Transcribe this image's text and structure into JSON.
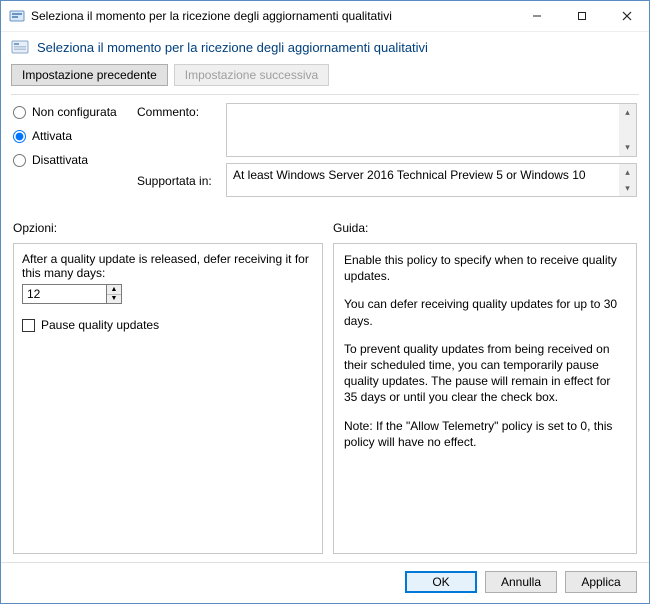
{
  "titlebar": {
    "title": "Seleziona il momento per la ricezione degli aggiornamenti qualitativi"
  },
  "header": {
    "title": "Seleziona il momento per la ricezione degli aggiornamenti qualitativi"
  },
  "nav": {
    "prev": "Impostazione precedente",
    "next": "Impostazione successiva"
  },
  "state": {
    "not_configured": "Non configurata",
    "enabled": "Attivata",
    "disabled": "Disattivata",
    "selected": "enabled"
  },
  "labels": {
    "comment": "Commento:",
    "supported": "Supportata in:",
    "options": "Opzioni:",
    "help": "Guida:"
  },
  "supported_text": "At least Windows Server 2016 Technical Preview 5 or Windows 10",
  "options": {
    "defer_label": "After a quality update is released, defer receiving it for this many days:",
    "defer_value": "12",
    "pause_label": "Pause quality updates",
    "pause_checked": false
  },
  "help": {
    "p1": "Enable this policy to specify when to receive quality updates.",
    "p2": "You can defer receiving quality updates for up to 30 days.",
    "p3": "To prevent quality updates from being received on their scheduled time, you can temporarily pause quality updates. The pause will remain in effect for 35 days or until you clear the check box.",
    "p4": "Note: If the \"Allow Telemetry\" policy is set to 0, this policy will have no effect."
  },
  "footer": {
    "ok": "OK",
    "cancel": "Annulla",
    "apply": "Applica"
  }
}
